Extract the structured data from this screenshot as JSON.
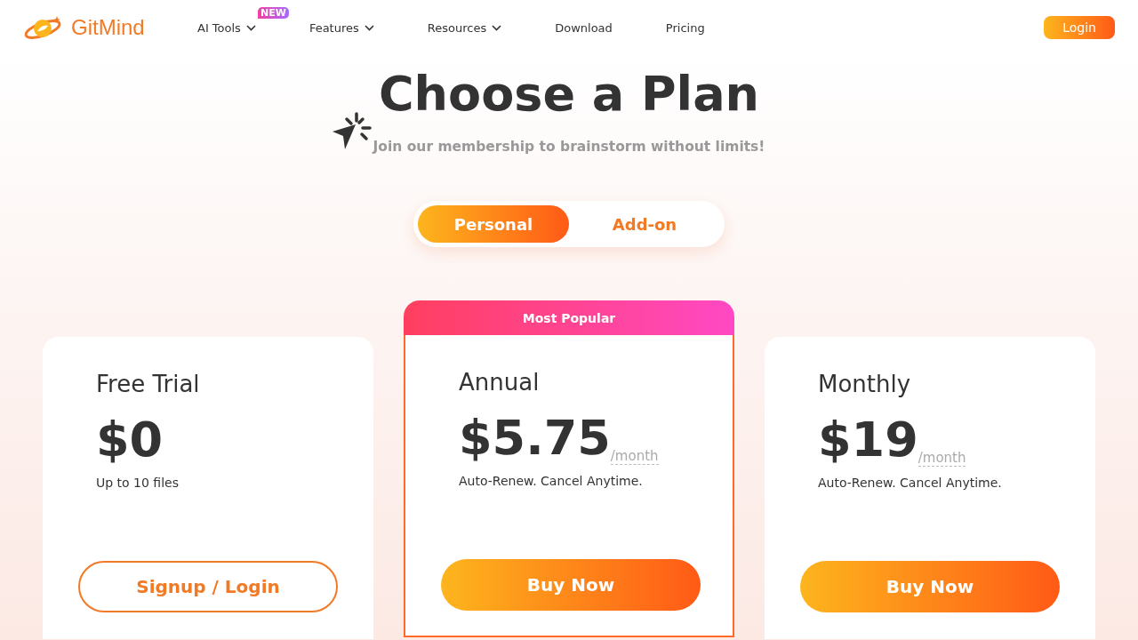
{
  "logo": {
    "text": "GitMind"
  },
  "nav": [
    {
      "label": "AI Tools",
      "dropdown": true,
      "badge": "NEW"
    },
    {
      "label": "Features",
      "dropdown": true
    },
    {
      "label": "Resources",
      "dropdown": true
    },
    {
      "label": "Download",
      "dropdown": false
    },
    {
      "label": "Pricing",
      "dropdown": false
    }
  ],
  "login": "Login",
  "hero": {
    "title": "Choose a Plan",
    "subtitle": "Join our membership to brainstorm without limits!"
  },
  "plan_tabs": [
    {
      "label": "Personal",
      "selected": true
    },
    {
      "label": "Add-on",
      "selected": false
    }
  ],
  "plans": [
    {
      "kind": "outline",
      "name": "Free Trial",
      "price": "$0",
      "note": "Up to 10 files",
      "button": "Signup / Login"
    },
    {
      "kind": "featured",
      "ribbon": "Most Popular",
      "name": "Annual",
      "price": "$5.75",
      "period": "/month",
      "note": "Auto-Renew. Cancel Anytime.",
      "button": "Buy Now"
    },
    {
      "kind": "filled",
      "name": "Monthly",
      "price": "$19",
      "period": "/month",
      "note": "Auto-Renew. Cancel Anytime.",
      "button": "Buy Now"
    }
  ]
}
